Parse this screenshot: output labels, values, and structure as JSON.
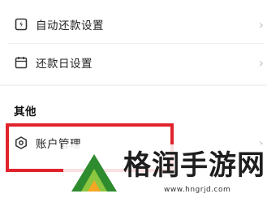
{
  "settings": {
    "auto_repay": {
      "label": "自动还款设置",
      "icon": "auto-repay-icon"
    },
    "repay_day": {
      "label": "还款日设置",
      "icon": "calendar-icon"
    }
  },
  "other": {
    "title": "其他",
    "account": {
      "label": "账户管理",
      "icon": "hexagon-gear-icon"
    }
  },
  "chevron": "›",
  "highlight_color": "#e0232c",
  "watermark": {
    "text": "格润手游网",
    "url": "www.hngrjd.com",
    "logo_colors": [
      "#2e8b2e",
      "#8dc63f",
      "#f5a623"
    ]
  }
}
